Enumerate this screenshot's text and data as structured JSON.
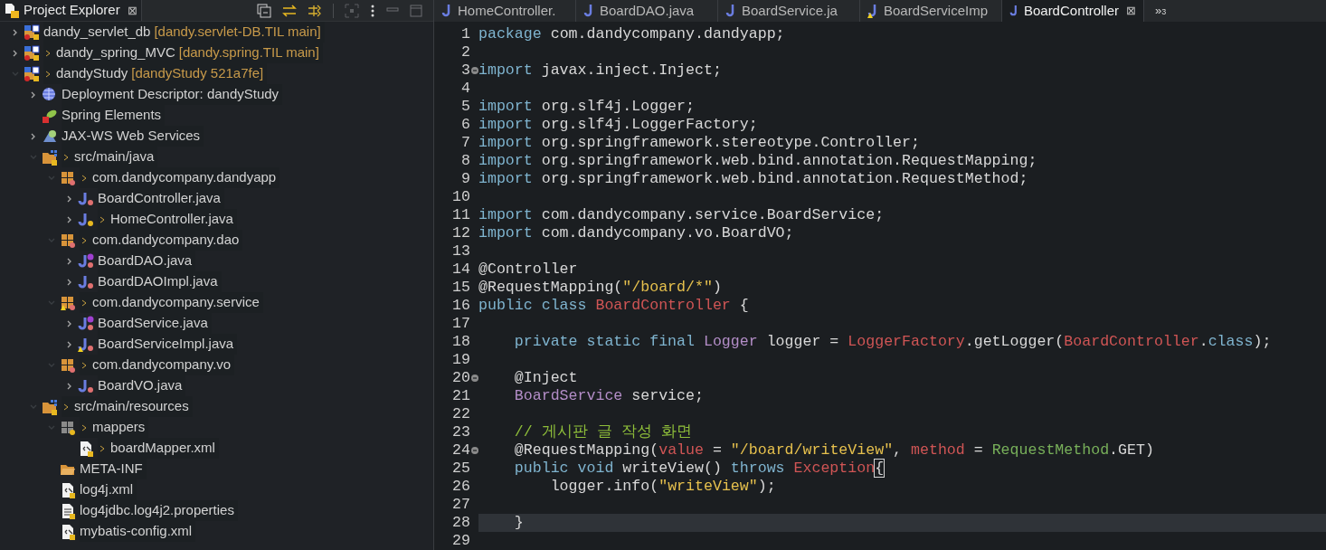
{
  "explorer": {
    "title": "Project Explorer",
    "close": "⊠",
    "tree": [
      {
        "name": "dandy_servlet_db",
        "decoration": "[dandy.servlet-DB.TIL main]",
        "kind": "project",
        "dirty": false,
        "expanded": false
      },
      {
        "name": "dandy_spring_MVC",
        "decoration": "[dandy.spring.TIL main]",
        "kind": "project",
        "dirty": true,
        "expanded": false
      },
      {
        "name": "dandyStudy",
        "decoration": "[dandyStudy 521a7fe]",
        "kind": "project",
        "dirty": true,
        "expanded": true,
        "children": [
          {
            "name": "Deployment Descriptor: dandyStudy",
            "kind": "deployment",
            "dirty": false,
            "expanded": false
          },
          {
            "name": "Spring Elements",
            "kind": "spring",
            "dirty": false
          },
          {
            "name": "JAX-WS Web Services",
            "kind": "webservices",
            "dirty": false,
            "expanded": false
          },
          {
            "name": "src/main/java",
            "kind": "source-folder",
            "dirty": true,
            "expanded": true,
            "children": [
              {
                "name": "com.dandycompany.dandyapp",
                "kind": "package",
                "dirty": true,
                "expanded": true,
                "children": [
                  {
                    "name": "BoardController.java",
                    "kind": "java",
                    "dirty": false,
                    "expanded": false
                  },
                  {
                    "name": "HomeController.java",
                    "kind": "java-synced",
                    "dirty": true,
                    "expanded": false
                  }
                ]
              },
              {
                "name": "com.dandycompany.dao",
                "kind": "package",
                "dirty": true,
                "expanded": true,
                "children": [
                  {
                    "name": "BoardDAO.java",
                    "kind": "java-interface",
                    "dirty": false,
                    "expanded": false
                  },
                  {
                    "name": "BoardDAOImpl.java",
                    "kind": "java",
                    "dirty": false,
                    "expanded": false
                  }
                ]
              },
              {
                "name": "com.dandycompany.service",
                "kind": "package-warning",
                "dirty": true,
                "expanded": true,
                "children": [
                  {
                    "name": "BoardService.java",
                    "kind": "java-interface",
                    "dirty": false,
                    "expanded": false
                  },
                  {
                    "name": "BoardServiceImpl.java",
                    "kind": "java-warning",
                    "dirty": false,
                    "expanded": false
                  }
                ]
              },
              {
                "name": "com.dandycompany.vo",
                "kind": "package",
                "dirty": true,
                "expanded": true,
                "children": [
                  {
                    "name": "BoardVO.java",
                    "kind": "java",
                    "dirty": false,
                    "expanded": false
                  }
                ]
              }
            ]
          },
          {
            "name": "src/main/resources",
            "kind": "source-folder",
            "dirty": true,
            "expanded": true,
            "children": [
              {
                "name": "mappers",
                "kind": "package-gray",
                "dirty": true,
                "expanded": true,
                "children": [
                  {
                    "name": "boardMapper.xml",
                    "kind": "xml",
                    "dirty": true
                  }
                ]
              },
              {
                "name": "META-INF",
                "kind": "folder",
                "dirty": false
              },
              {
                "name": "log4j.xml",
                "kind": "xml",
                "dirty": false
              },
              {
                "name": "log4jdbc.log4j2.properties",
                "kind": "properties",
                "dirty": false
              },
              {
                "name": "mybatis-config.xml",
                "kind": "xml",
                "dirty": false
              }
            ]
          }
        ]
      }
    ]
  },
  "editor": {
    "tabs": [
      {
        "label": "HomeController.",
        "selected": false,
        "warning": false
      },
      {
        "label": "BoardDAO.java",
        "selected": false,
        "warning": false
      },
      {
        "label": "BoardService.ja",
        "selected": false,
        "warning": false
      },
      {
        "label": "BoardServiceImp",
        "selected": false,
        "warning": true
      },
      {
        "label": "BoardController",
        "selected": true,
        "warning": false,
        "close": "⊠"
      }
    ],
    "overflow": "»",
    "overflow_count": "3",
    "lines": [
      {
        "number": "1",
        "fold": false,
        "selected": false,
        "tokens": [
          {
            "kind": "keyword",
            "text": "package"
          },
          {
            "kind": "plain",
            "text": " com.dandycompany.dandyapp;"
          }
        ]
      },
      {
        "number": "2",
        "fold": false,
        "selected": false
      },
      {
        "number": "3",
        "fold": true,
        "selected": false,
        "tokens": [
          {
            "kind": "keyword",
            "text": "import"
          },
          {
            "kind": "plain",
            "text": " javax.inject.Inject;"
          }
        ]
      },
      {
        "number": "4",
        "fold": false,
        "selected": false
      },
      {
        "number": "5",
        "fold": false,
        "selected": false,
        "tokens": [
          {
            "kind": "keyword",
            "text": "import"
          },
          {
            "kind": "plain",
            "text": " org.slf4j.Logger;"
          }
        ]
      },
      {
        "number": "6",
        "fold": false,
        "selected": false,
        "tokens": [
          {
            "kind": "keyword",
            "text": "import"
          },
          {
            "kind": "plain",
            "text": " org.slf4j.LoggerFactory;"
          }
        ]
      },
      {
        "number": "7",
        "fold": false,
        "selected": false,
        "tokens": [
          {
            "kind": "keyword",
            "text": "import"
          },
          {
            "kind": "plain",
            "text": " org.springframework.stereotype.Controller;"
          }
        ]
      },
      {
        "number": "8",
        "fold": false,
        "selected": false,
        "tokens": [
          {
            "kind": "keyword",
            "text": "import"
          },
          {
            "kind": "plain",
            "text": " org.springframework.web.bind.annotation.RequestMapping;"
          }
        ]
      },
      {
        "number": "9",
        "fold": false,
        "selected": false,
        "tokens": [
          {
            "kind": "keyword",
            "text": "import"
          },
          {
            "kind": "plain",
            "text": " org.springframework.web.bind.annotation.RequestMethod;"
          }
        ]
      },
      {
        "number": "10",
        "fold": false,
        "selected": false
      },
      {
        "number": "11",
        "fold": false,
        "selected": false,
        "tokens": [
          {
            "kind": "keyword",
            "text": "import"
          },
          {
            "kind": "plain",
            "text": " com.dandycompany.service.BoardService;"
          }
        ]
      },
      {
        "number": "12",
        "fold": false,
        "selected": false,
        "tokens": [
          {
            "kind": "keyword",
            "text": "import"
          },
          {
            "kind": "plain",
            "text": " com.dandycompany.vo.BoardVO;"
          }
        ]
      },
      {
        "number": "13",
        "fold": false,
        "selected": false
      },
      {
        "number": "14",
        "fold": false,
        "selected": false,
        "tokens": [
          {
            "kind": "plain",
            "text": "@Controller"
          }
        ]
      },
      {
        "number": "15",
        "fold": false,
        "selected": false,
        "tokens": [
          {
            "kind": "plain",
            "text": "@RequestMapping("
          },
          {
            "kind": "string",
            "text": "\"/board/*\""
          },
          {
            "kind": "plain",
            "text": ")"
          }
        ]
      },
      {
        "number": "16",
        "fold": false,
        "selected": false,
        "tokens": [
          {
            "kind": "keyword",
            "text": "public class "
          },
          {
            "kind": "class",
            "text": "BoardController"
          },
          {
            "kind": "plain",
            "text": " {"
          }
        ]
      },
      {
        "number": "17",
        "fold": false,
        "selected": false
      },
      {
        "number": "18",
        "fold": false,
        "selected": false,
        "tokens": [
          {
            "kind": "keyword",
            "text": "    private static final "
          },
          {
            "kind": "type",
            "text": "Logger"
          },
          {
            "kind": "plain",
            "text": " logger = "
          },
          {
            "kind": "class",
            "text": "LoggerFactory"
          },
          {
            "kind": "plain",
            "text": ".getLogger("
          },
          {
            "kind": "class",
            "text": "BoardController"
          },
          {
            "kind": "plain",
            "text": "."
          },
          {
            "kind": "keyword",
            "text": "class"
          },
          {
            "kind": "plain",
            "text": ");"
          }
        ]
      },
      {
        "number": "19",
        "fold": false,
        "selected": false
      },
      {
        "number": "20",
        "fold": true,
        "selected": false,
        "tokens": [
          {
            "kind": "plain",
            "text": "    @Inject"
          }
        ]
      },
      {
        "number": "21",
        "fold": false,
        "selected": false,
        "tokens": [
          {
            "kind": "interface",
            "text": "    BoardService"
          },
          {
            "kind": "plain",
            "text": " service;"
          }
        ]
      },
      {
        "number": "22",
        "fold": false,
        "selected": false
      },
      {
        "number": "23",
        "fold": false,
        "selected": false,
        "tokens": [
          {
            "kind": "comment",
            "text": "    // 게시판 글 작성 화면"
          }
        ]
      },
      {
        "number": "24",
        "fold": true,
        "selected": false,
        "tokens": [
          {
            "kind": "plain",
            "text": "    @RequestMapping("
          },
          {
            "kind": "class",
            "text": "value"
          },
          {
            "kind": "plain",
            "text": " = "
          },
          {
            "kind": "string",
            "text": "\"/board/writeView\""
          },
          {
            "kind": "plain",
            "text": ", "
          },
          {
            "kind": "class",
            "text": "method"
          },
          {
            "kind": "plain",
            "text": " = "
          },
          {
            "kind": "enum",
            "text": "RequestMethod"
          },
          {
            "kind": "plain",
            "text": ".GET)"
          }
        ]
      },
      {
        "number": "25",
        "fold": false,
        "selected": false,
        "tokens": [
          {
            "kind": "keyword",
            "text": "    public void"
          },
          {
            "kind": "plain",
            "text": " writeView() "
          },
          {
            "kind": "keyword",
            "text": "throws"
          },
          {
            "kind": "class",
            "text": " Exception"
          },
          {
            "kind": "bracket",
            "text": "{"
          }
        ]
      },
      {
        "number": "26",
        "fold": false,
        "selected": false,
        "tokens": [
          {
            "kind": "plain",
            "text": "        logger.info("
          },
          {
            "kind": "string",
            "text": "\"writeView\""
          },
          {
            "kind": "plain",
            "text": ");"
          }
        ]
      },
      {
        "number": "27",
        "fold": false,
        "selected": false
      },
      {
        "number": "28",
        "fold": false,
        "selected": true,
        "tokens": [
          {
            "kind": "plain",
            "text": "    }"
          }
        ]
      },
      {
        "number": "29",
        "fold": false,
        "selected": false
      }
    ]
  }
}
